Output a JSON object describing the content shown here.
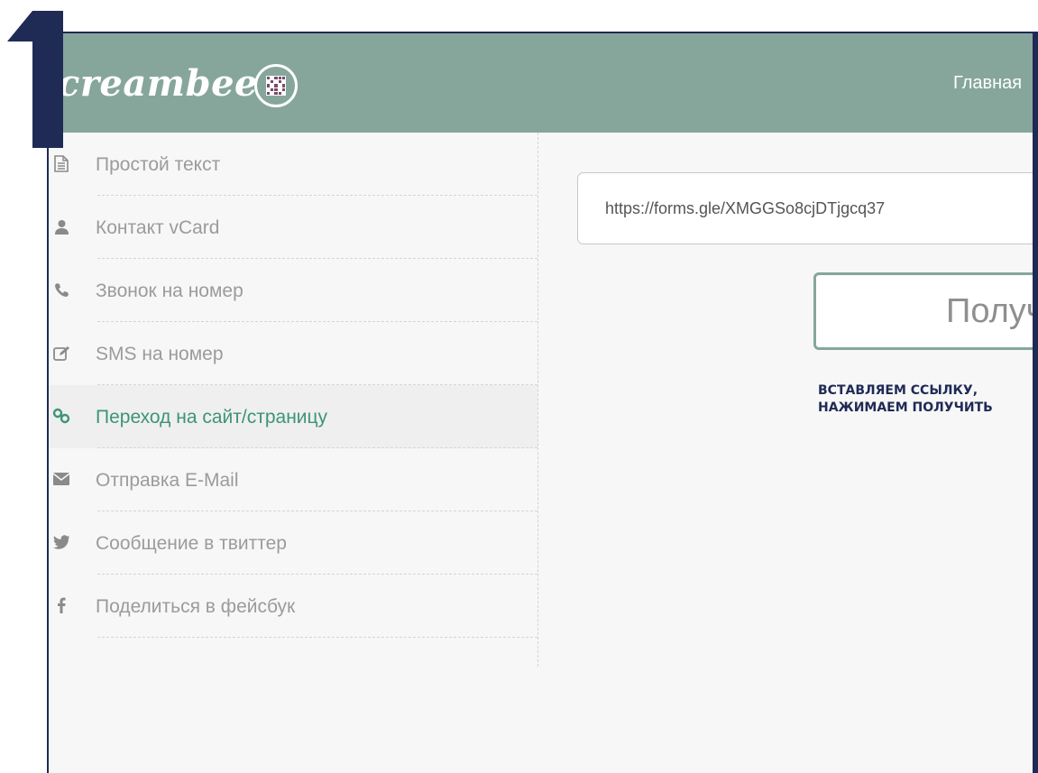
{
  "header": {
    "logo_text": "creambee",
    "nav_home": "Главная"
  },
  "annotation": {
    "step_number": "1",
    "line1": "ВСТАВЛЯЕМ ССЫЛКУ,",
    "line2": "НАЖИМАЕМ ПОЛУЧИТЬ"
  },
  "sidebar": {
    "items": [
      {
        "label": "Простой текст",
        "icon": "document-icon"
      },
      {
        "label": "Контакт vCard",
        "icon": "user-icon"
      },
      {
        "label": "Звонок на номер",
        "icon": "phone-icon"
      },
      {
        "label": "SMS на номер",
        "icon": "edit-icon"
      },
      {
        "label": "Переход на сайт/страницу",
        "icon": "link-icon",
        "active": true
      },
      {
        "label": "Отправка E-Mail",
        "icon": "envelope-icon"
      },
      {
        "label": "Сообщение в твиттер",
        "icon": "twitter-icon"
      },
      {
        "label": "Поделиться в фейсбук",
        "icon": "facebook-icon"
      }
    ]
  },
  "form": {
    "url_value": "https://forms.gle/XMGGSo8cjDTjgcq37",
    "button_label": "Получ"
  },
  "colors": {
    "header_bg": "#86a69c",
    "accent_green": "#3e9477",
    "annotation_navy": "#1f2a55"
  }
}
